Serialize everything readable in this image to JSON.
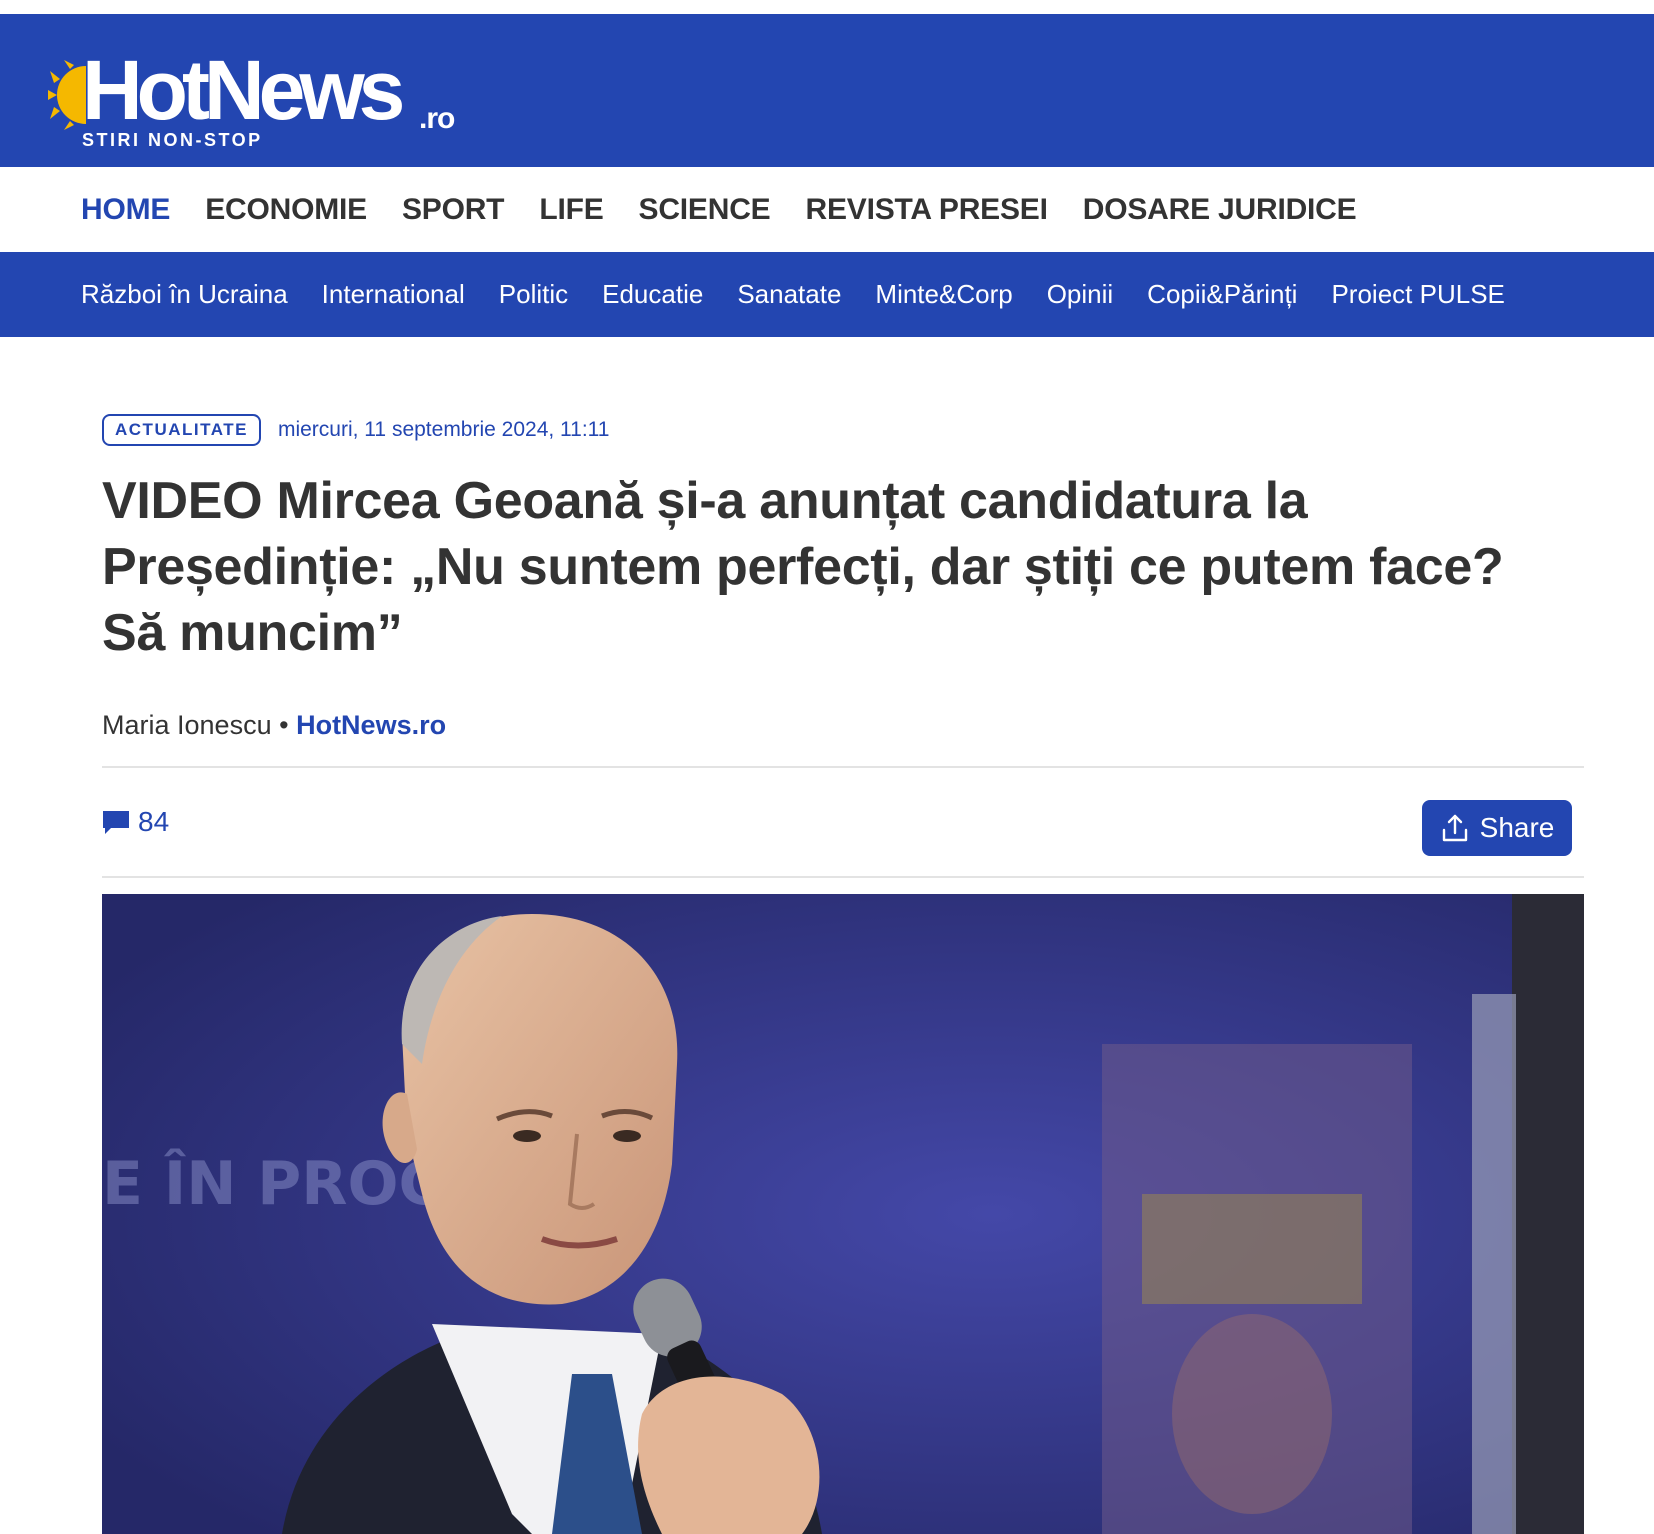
{
  "brand": {
    "name": "HotNews",
    "tld": ".ro",
    "tagline": "STIRI NON-STOP",
    "color": "#2346b1",
    "sun_color": "#f5b800"
  },
  "main_nav": {
    "items": [
      {
        "label": "HOME",
        "active": true
      },
      {
        "label": "ECONOMIE"
      },
      {
        "label": "SPORT"
      },
      {
        "label": "LIFE"
      },
      {
        "label": "SCIENCE"
      },
      {
        "label": "REVISTA PRESEI"
      },
      {
        "label": "DOSARE JURIDICE"
      }
    ]
  },
  "sub_nav": {
    "items": [
      {
        "label": "Război în Ucraina"
      },
      {
        "label": "International"
      },
      {
        "label": "Politic"
      },
      {
        "label": "Educatie"
      },
      {
        "label": "Sanatate"
      },
      {
        "label": "Minte&Corp"
      },
      {
        "label": "Opinii"
      },
      {
        "label": "Copii&Părinți"
      },
      {
        "label": "Proiect PULSE"
      }
    ]
  },
  "article": {
    "category": "ACTUALITATE",
    "date": "miercuri, 11 septembrie 2024, 11:11",
    "headline": "VIDEO Mircea Geoană și-a anunțat candidatura la Președinție: „Nu suntem perfecți, dar știți ce putem face? Să muncim”",
    "author": "Maria Ionescu",
    "byline_separator": "•",
    "source": "HotNews.ro",
    "comments_count": "84",
    "share_label": "Share",
    "hero_icon": "speaker-photo"
  }
}
